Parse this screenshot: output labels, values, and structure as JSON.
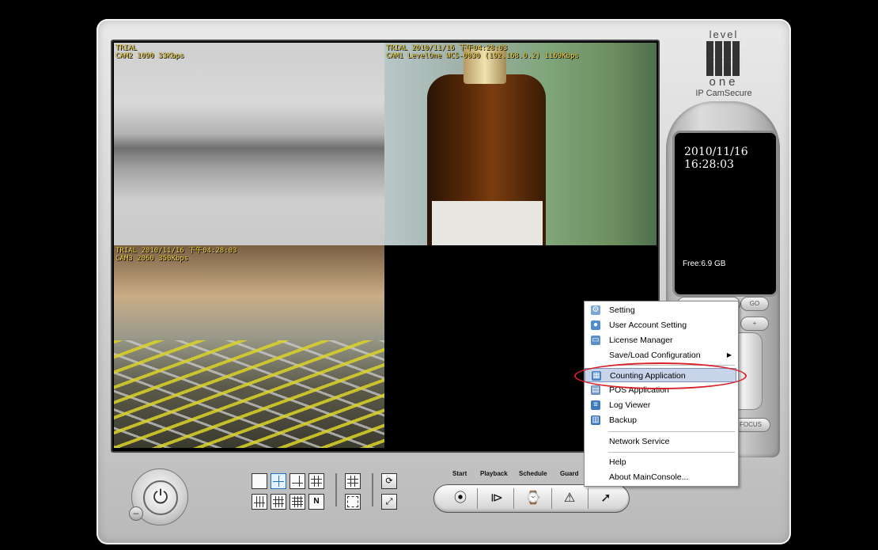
{
  "cameras": {
    "cam2": {
      "line1": "TRIAL",
      "line2": "CAM2 1090 33Kbps"
    },
    "cam1": {
      "line1": "TRIAL 2010/11/16 下午04:28:03",
      "line2": "CAM1 LevelOne WCS-0030 (192.168.0.2) 1169Kbps"
    },
    "cam3": {
      "line1": "TRIAL 2010/11/16 下午04:28:03",
      "line2": "CAM3 2060 350Kbps"
    }
  },
  "brand": {
    "top": "level",
    "bottom": "one",
    "product": "IP CamSecure"
  },
  "status": {
    "date": "2010/11/16",
    "time": "16:28:03",
    "free_space": "Free:6.9 GB"
  },
  "side_controls": {
    "go_label": "GO",
    "plus_label": "+",
    "focus_label": "FOCUS"
  },
  "control_labels": {
    "start": "Start",
    "playback": "Playback",
    "schedule": "Schedule",
    "guard": "Guard"
  },
  "layout_buttons": {
    "n_label": "N"
  },
  "menu": {
    "items": [
      {
        "label": "Setting",
        "icon": "gear-icon"
      },
      {
        "label": "User Account Setting",
        "icon": "user-icon"
      },
      {
        "label": "License Manager",
        "icon": "license-icon"
      },
      {
        "label": "Save/Load Configuration",
        "icon": "",
        "submenu": true
      },
      {
        "label": "Counting Application",
        "icon": "counting-icon",
        "highlighted": true
      },
      {
        "label": "POS Application",
        "icon": "pos-icon"
      },
      {
        "label": "Log Viewer",
        "icon": "log-icon"
      },
      {
        "label": "Backup",
        "icon": "backup-icon"
      },
      {
        "label": "Network Service",
        "icon": ""
      },
      {
        "label": "Help",
        "icon": ""
      },
      {
        "label": "About MainConsole...",
        "icon": ""
      }
    ]
  },
  "colors": {
    "osd_text": "#ffe14a",
    "highlight": "#c8d4ea",
    "annotation_ring": "#d8222a"
  }
}
